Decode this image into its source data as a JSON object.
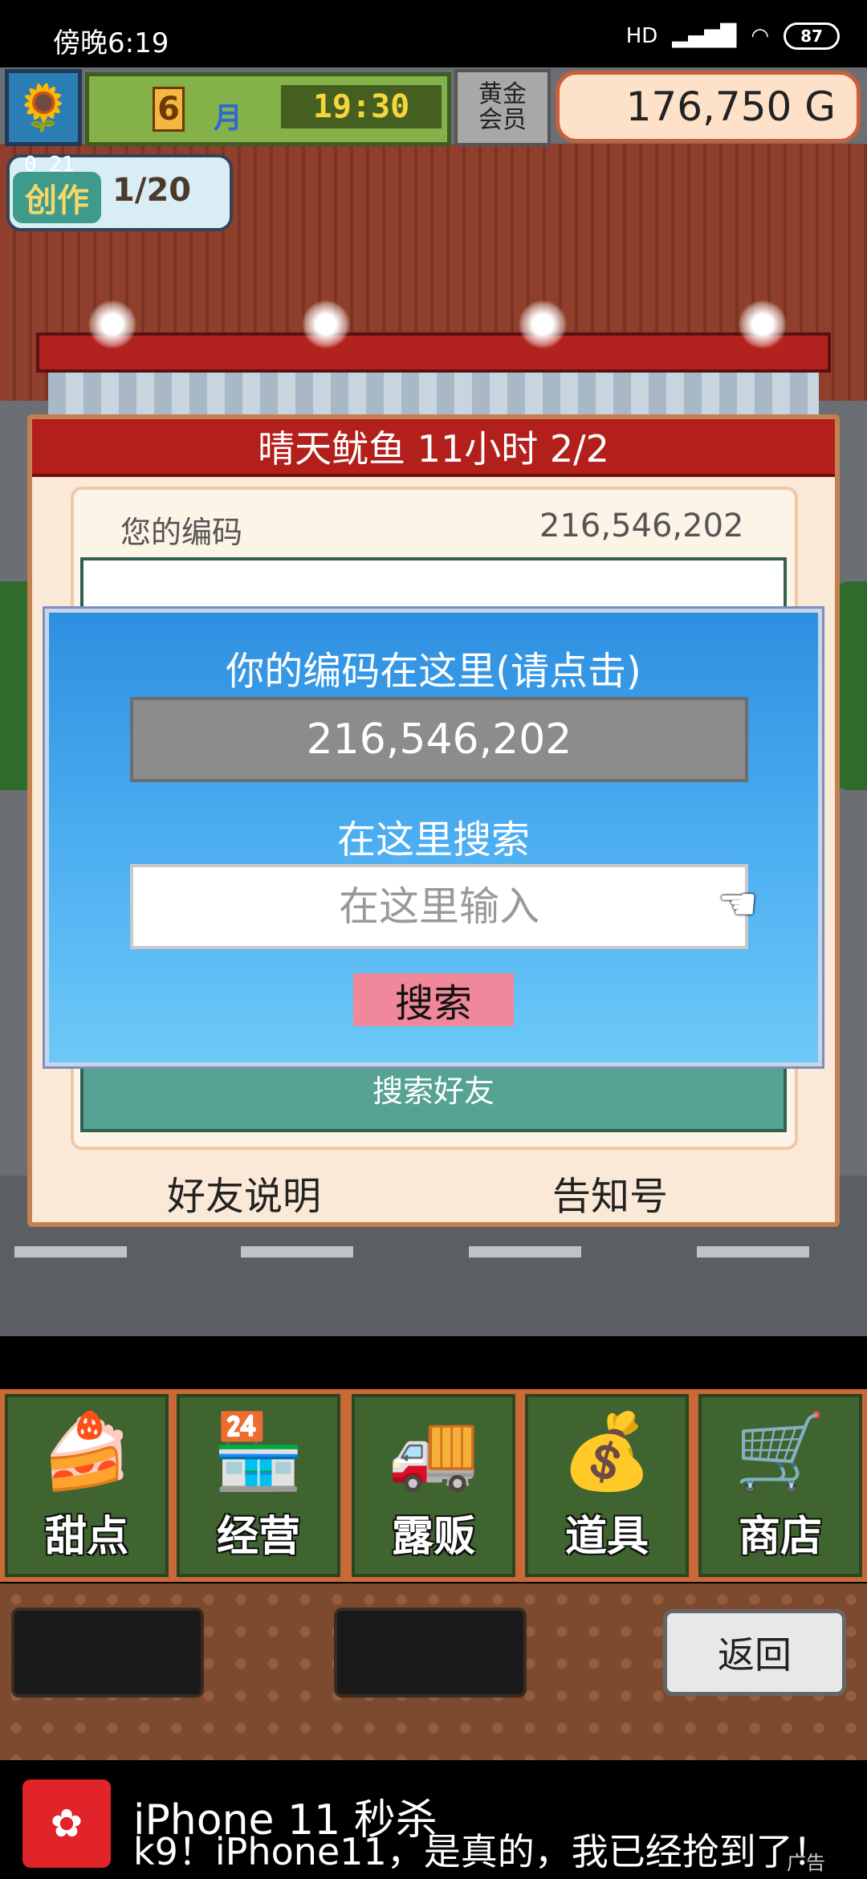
{
  "status_bar": {
    "time": "傍晚6:19",
    "network": "HD",
    "battery": "87"
  },
  "hud": {
    "month_number": "6",
    "month_label": "月",
    "clock": "19:30",
    "gold_member_line1": "黄金",
    "gold_member_line2": "会员",
    "money": "176,750 G",
    "create_label": "创作",
    "create_counter": "1/20",
    "create_timer": "0 21"
  },
  "panel": {
    "title": "晴天鱿鱼  11小时 2/2",
    "code_label": "您的编码",
    "code_value": "216,546,202",
    "search_friends": "搜索好友",
    "friends_help": "好友说明",
    "notice_number": "告知号"
  },
  "dialog": {
    "title": "你的编码在这里(请点击)",
    "code": "216,546,202",
    "search_title": "在这里搜索",
    "input_placeholder": "在这里输入",
    "search_button": "搜索"
  },
  "menu": [
    {
      "label": "甜点",
      "icon": "cake-icon"
    },
    {
      "label": "经营",
      "icon": "shop-icon"
    },
    {
      "label": "露贩",
      "icon": "food-truck-icon"
    },
    {
      "label": "道具",
      "icon": "item-bag-icon"
    },
    {
      "label": "商店",
      "icon": "cart-icon"
    }
  ],
  "back_button": "返回",
  "ad": {
    "title": "iPhone 11 秒杀",
    "subtitle": "k9！iPhone11，是真的，我已经抢到了！",
    "tag": "广告"
  }
}
